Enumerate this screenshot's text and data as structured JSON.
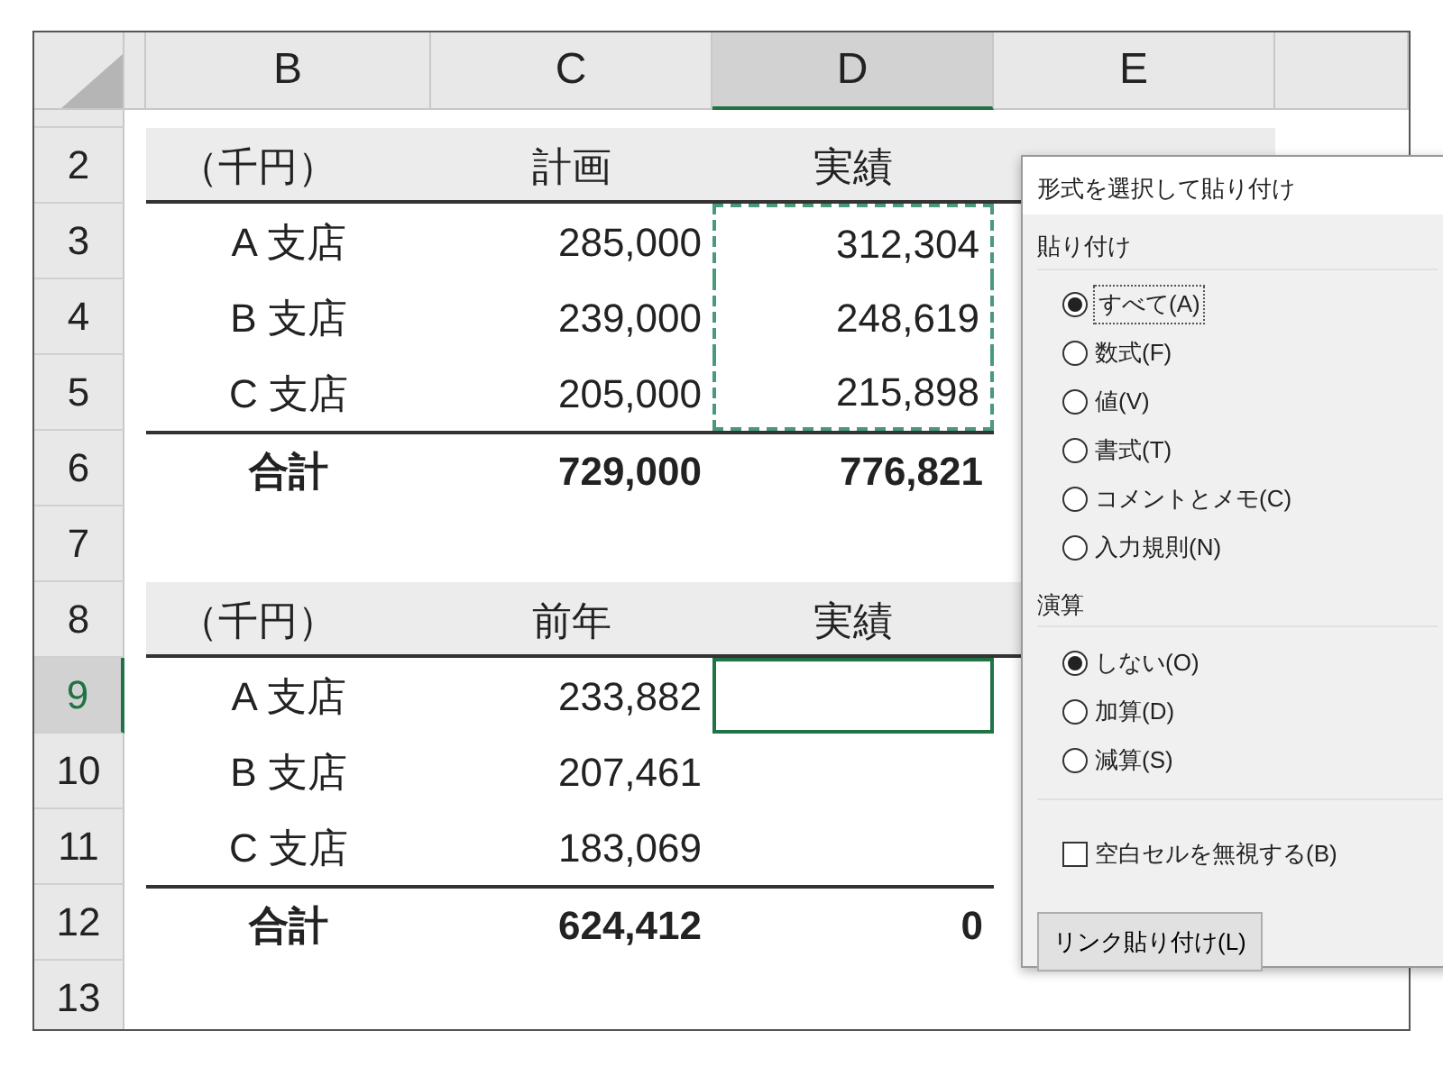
{
  "columns": [
    {
      "selected": false
    },
    {
      "label": "B",
      "selected": false
    },
    {
      "label": "C",
      "selected": false
    },
    {
      "label": "D",
      "selected": true
    },
    {
      "label": "E",
      "selected": false
    }
  ],
  "rows": [
    {
      "number": "2",
      "kind": "header",
      "selected": false,
      "copied": false,
      "cells": [
        "（千円）",
        "計画",
        "実績"
      ]
    },
    {
      "number": "3",
      "kind": "data",
      "selected": false,
      "copied": true,
      "cells": [
        "A 支店",
        "285,000",
        "312,304"
      ]
    },
    {
      "number": "4",
      "kind": "data",
      "selected": false,
      "copied": true,
      "cells": [
        "B 支店",
        "239,000",
        "248,619"
      ]
    },
    {
      "number": "5",
      "kind": "data",
      "selected": false,
      "copied": true,
      "cells": [
        "C 支店",
        "205,000",
        "215,898"
      ]
    },
    {
      "number": "6",
      "kind": "total",
      "selected": false,
      "copied": false,
      "cells": [
        "合計",
        "729,000",
        "776,821"
      ]
    },
    {
      "number": "7",
      "kind": "blank",
      "selected": false,
      "copied": false,
      "cells": []
    },
    {
      "number": "8",
      "kind": "header",
      "selected": false,
      "copied": false,
      "cells": [
        "（千円）",
        "前年",
        "実績"
      ]
    },
    {
      "number": "9",
      "kind": "data",
      "selected": true,
      "copied": false,
      "cells": [
        "A 支店",
        "233,882"
      ]
    },
    {
      "number": "10",
      "kind": "data",
      "selected": false,
      "copied": false,
      "cells": [
        "B 支店",
        "207,461"
      ]
    },
    {
      "number": "11",
      "kind": "data",
      "selected": false,
      "copied": false,
      "cells": [
        "C 支店",
        "183,069"
      ]
    },
    {
      "number": "12",
      "kind": "total",
      "selected": false,
      "copied": false,
      "cells": [
        "合計",
        "624,412",
        "0"
      ]
    },
    {
      "number": "13",
      "kind": "blank",
      "selected": false,
      "copied": false,
      "cells": []
    }
  ],
  "dialog": {
    "title": "形式を選択して貼り付け",
    "sections": [
      {
        "label": "貼り付け",
        "options": [
          {
            "label": "すべて(A)",
            "selected": true,
            "focused": true
          },
          {
            "label": "数式(F)",
            "selected": false,
            "focused": false
          },
          {
            "label": "値(V)",
            "selected": false,
            "focused": false
          },
          {
            "label": "書式(T)",
            "selected": false,
            "focused": false
          },
          {
            "label": "コメントとメモ(C)",
            "selected": false,
            "focused": false
          },
          {
            "label": "入力規則(N)",
            "selected": false,
            "focused": false
          }
        ]
      },
      {
        "label": "演算",
        "options": [
          {
            "label": "しない(O)",
            "selected": true,
            "focused": false
          },
          {
            "label": "加算(D)",
            "selected": false,
            "focused": false
          },
          {
            "label": "減算(S)",
            "selected": false,
            "focused": false
          }
        ]
      }
    ],
    "checkbox": {
      "label": "空白セルを無視する(B)",
      "checked": false
    },
    "button": "リンク貼り付け(L)"
  }
}
